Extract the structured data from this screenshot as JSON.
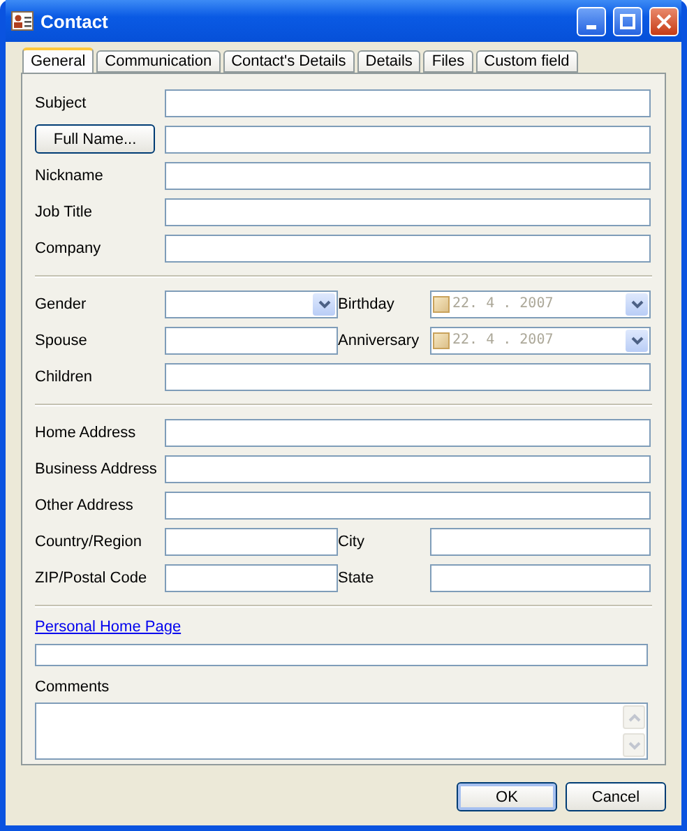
{
  "window": {
    "title": "Contact"
  },
  "tabs": [
    {
      "label": "General",
      "selected": true
    },
    {
      "label": "Communication",
      "selected": false
    },
    {
      "label": "Contact's Details",
      "selected": false
    },
    {
      "label": "Details",
      "selected": false
    },
    {
      "label": "Files",
      "selected": false
    },
    {
      "label": "Custom field",
      "selected": false
    }
  ],
  "sections": [
    {
      "rows": [
        {
          "fields": [
            {
              "kind": "text",
              "label": "Subject"
            }
          ]
        },
        {
          "fields": [
            {
              "kind": "button_text",
              "label": "Full Name..."
            }
          ]
        },
        {
          "fields": [
            {
              "kind": "text",
              "label": "Nickname"
            }
          ]
        },
        {
          "fields": [
            {
              "kind": "text",
              "label": "Job Title"
            }
          ]
        },
        {
          "fields": [
            {
              "kind": "text",
              "label": "Company"
            }
          ]
        }
      ]
    },
    {
      "rows": [
        {
          "fields": [
            {
              "kind": "combo",
              "label": "Gender"
            },
            {
              "kind": "date",
              "label": "Birthday",
              "value": "22. 4 . 2007",
              "checked": false
            }
          ]
        },
        {
          "fields": [
            {
              "kind": "text",
              "label": "Spouse"
            },
            {
              "kind": "date",
              "label": "Anniversary",
              "value": "22. 4 . 2007",
              "checked": false
            }
          ]
        },
        {
          "fields": [
            {
              "kind": "text",
              "label": "Children"
            }
          ]
        }
      ]
    },
    {
      "rows": [
        {
          "fields": [
            {
              "kind": "text",
              "label": "Home Address"
            }
          ]
        },
        {
          "fields": [
            {
              "kind": "text",
              "label": "Business Address"
            }
          ]
        },
        {
          "fields": [
            {
              "kind": "text",
              "label": "Other Address"
            }
          ]
        },
        {
          "fields": [
            {
              "kind": "text",
              "label": "Country/Region"
            },
            {
              "kind": "text",
              "label": "City"
            }
          ]
        },
        {
          "fields": [
            {
              "kind": "text",
              "label": "ZIP/Postal Code"
            },
            {
              "kind": "text",
              "label": "State"
            }
          ]
        }
      ]
    }
  ],
  "home_page": {
    "label": "Personal Home Page"
  },
  "comments": {
    "label": "Comments"
  },
  "buttons": [
    {
      "label": "OK",
      "default": true
    },
    {
      "label": "Cancel",
      "default": false
    }
  ]
}
